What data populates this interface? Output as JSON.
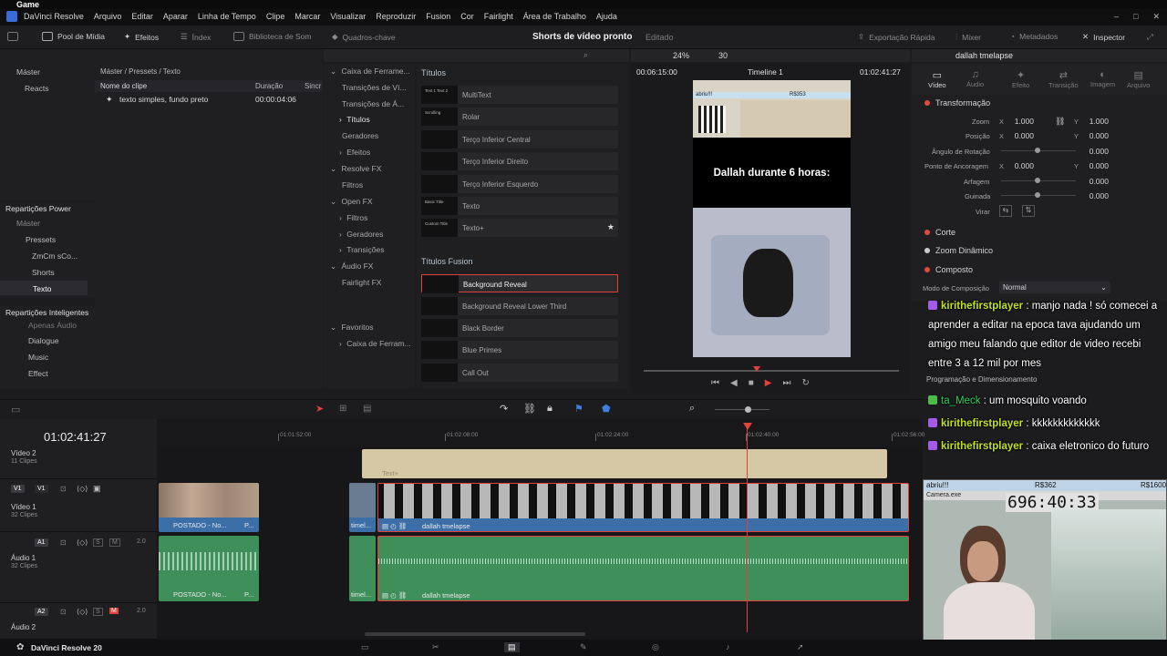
{
  "window": {
    "title": "Game"
  },
  "menu": [
    "DaVinci Resolve",
    "Arquivo",
    "Editar",
    "Aparar",
    "Linha de Tempo",
    "Clipe",
    "Marcar",
    "Visualizar",
    "Reproduzir",
    "Fusion",
    "Cor",
    "Fairlight",
    "Área de Trabalho",
    "Ajuda"
  ],
  "toolbar": {
    "media_pool": "Pool de Mídia",
    "effects": "Efeitos",
    "index": "Índex",
    "sound_library": "Biblioteca de Som",
    "keyframes": "Quadros-chave",
    "project_title": "Shorts de vídeo pronto",
    "project_status": "Editado",
    "quick_export": "Exportação Rápida",
    "mixer": "Mixer",
    "metadata": "Metadados",
    "inspector": "Inspector"
  },
  "media_pool": {
    "bins": [
      "Máster",
      "Reacts"
    ],
    "power_bins_title": "Repartições Power",
    "power_bins": [
      "Máster",
      "Pressets",
      "ZmCm sCo...",
      "Shorts",
      "Texto"
    ],
    "smart_bins_title": "Repartições Inteligentes",
    "smart_bins": [
      "Apenas Áudio",
      "Dialogue",
      "Music",
      "Effect"
    ],
    "breadcrumb": "Máster / Pressets / Texto",
    "columns": {
      "name": "Nome do clipe",
      "duration": "Duração",
      "sync": "Sincr"
    },
    "clips": [
      {
        "name": "texto simples, fundo preto",
        "duration": "00:00:04:06"
      }
    ]
  },
  "effects_tree": {
    "items": [
      {
        "label": "Caixa de Ferrame...",
        "level": 0,
        "expanded": true
      },
      {
        "label": "Transições de Ví...",
        "level": 1
      },
      {
        "label": "Transições de Á...",
        "level": 1
      },
      {
        "label": "Títulos",
        "level": 1,
        "selected": true
      },
      {
        "label": "Geradores",
        "level": 1
      },
      {
        "label": "Efeitos",
        "level": 1
      },
      {
        "label": "Resolve FX",
        "level": 0,
        "expanded": true
      },
      {
        "label": "Filtros",
        "level": 1
      },
      {
        "label": "Open FX",
        "level": 0,
        "expanded": true
      },
      {
        "label": "Filtros",
        "level": 1
      },
      {
        "label": "Geradores",
        "level": 1
      },
      {
        "label": "Transições",
        "level": 1
      },
      {
        "label": "Áudio FX",
        "level": 0,
        "expanded": true
      },
      {
        "label": "Fairlight FX",
        "level": 1
      },
      {
        "label": "Favoritos",
        "level": 0,
        "expanded": true
      },
      {
        "label": "Caixa de Ferram...",
        "level": 1
      }
    ]
  },
  "effects_list": {
    "section1": "Títulos",
    "titles": [
      {
        "label": "MultiText",
        "thumb": "Text 1 Text 2"
      },
      {
        "label": "Rolar",
        "thumb": "Scrolling"
      },
      {
        "label": "Terço Inferior Central",
        "thumb": ""
      },
      {
        "label": "Terço Inferior Direito",
        "thumb": ""
      },
      {
        "label": "Terço Inferior Esquerdo",
        "thumb": ""
      },
      {
        "label": "Texto",
        "thumb": "Basic Title"
      },
      {
        "label": "Texto+",
        "thumb": "Custom Title",
        "favorite": true
      }
    ],
    "section2": "Títulos Fusion",
    "fusion_titles": [
      {
        "label": "Background Reveal",
        "selected": true
      },
      {
        "label": "Background Reveal Lower Third"
      },
      {
        "label": "Black Border"
      },
      {
        "label": "Blue Primes"
      },
      {
        "label": "Call Out"
      }
    ]
  },
  "viewer": {
    "zoom": "24%",
    "fps": "30",
    "source_tc": "00:06:15:00",
    "timeline_name": "Timeline 1",
    "record_tc": "01:02:41:27",
    "frame_text": "Dallah durante 6 horas:",
    "frame_top_label": "abriu!!!",
    "frame_top_value": "R$353"
  },
  "inspector": {
    "clip_name": "dallah tmelapse",
    "tabs": [
      "Vídeo",
      "Áudio",
      "Efeito",
      "Transição",
      "Imagem",
      "Arquivo"
    ],
    "transform": "Transformação",
    "zoom_label": "Zoom",
    "zoom_x": "1.000",
    "zoom_y": "1.000",
    "position_label": "Posição",
    "pos_x": "0.000",
    "pos_y": "0.000",
    "rotation_label": "Ângulo de Rotação",
    "rotation": "0.000",
    "anchor_label": "Ponto de Ancoragem",
    "anchor_x": "0.000",
    "anchor_y": "0.000",
    "pitch_label": "Arfagem",
    "pitch": "0.000",
    "yaw_label": "Guinada",
    "yaw": "0.000",
    "flip_label": "Virar",
    "crop": "Corte",
    "dynamic_zoom": "Zoom Dinâmico",
    "composite": "Composto",
    "composite_mode_label": "Modo de Composição",
    "composite_mode": "Normal",
    "hidden_section": "Programação e Dimensionamento"
  },
  "chat": [
    {
      "user": "kirithefirstplayer",
      "message": " : manjo nada ! só comecei a aprender a editar na epoca tava ajudando um amigo meu falando que editor de video recebi entre 3 a 12 mil por mes",
      "badge": "purple"
    },
    {
      "user": "ta_Meck",
      "message": " : um mosquito voando",
      "badge": "green"
    },
    {
      "user": "kirithefirstplayer",
      "message": " : kkkkkkkkkkkkk",
      "badge": "purple"
    },
    {
      "user": "kirithefirstplayer",
      "message": " : caixa eletronico do futuro",
      "badge": "purple"
    }
  ],
  "timeline": {
    "timecode": "01:02:41:27",
    "ruler": [
      "01:01:52:00",
      "01:02:08:00",
      "01:02:24:00",
      "01:02:40:00",
      "01:02:56:00"
    ],
    "tracks": [
      {
        "id": "",
        "name": "Vídeo 2",
        "clips": "11 Clipes"
      },
      {
        "id": "V1",
        "name": "Vídeo 1",
        "clips": "32 Clipes"
      },
      {
        "id": "A1",
        "name": "Áudio 1",
        "clips": "32 Clipes",
        "level": "2.0"
      },
      {
        "id": "A2",
        "name": "Áudio 2",
        "level": "2.0"
      }
    ],
    "clip_labels": {
      "text_plus": "Text+",
      "posted_video": "POSTADO - No...",
      "posted_video_b": "P...",
      "timel_short": "timel...",
      "dallah": "dallah tmelapse",
      "posted_audio": "POSTADO - No...",
      "posted_audio_b": "P..."
    }
  },
  "webcam": {
    "label_left": "abriu!!!",
    "value_mid": "R$362",
    "value_right": "R$1600",
    "window": "Camera.exe",
    "timer": "696:40:33"
  },
  "pagebar": {
    "app": "DaVinci Resolve 20"
  },
  "colors": {
    "accent_red": "#e0413a",
    "clip_blue": "#3c6fa8",
    "audio_green": "#3f8f5a",
    "text_clip": "#d6c8a4"
  }
}
